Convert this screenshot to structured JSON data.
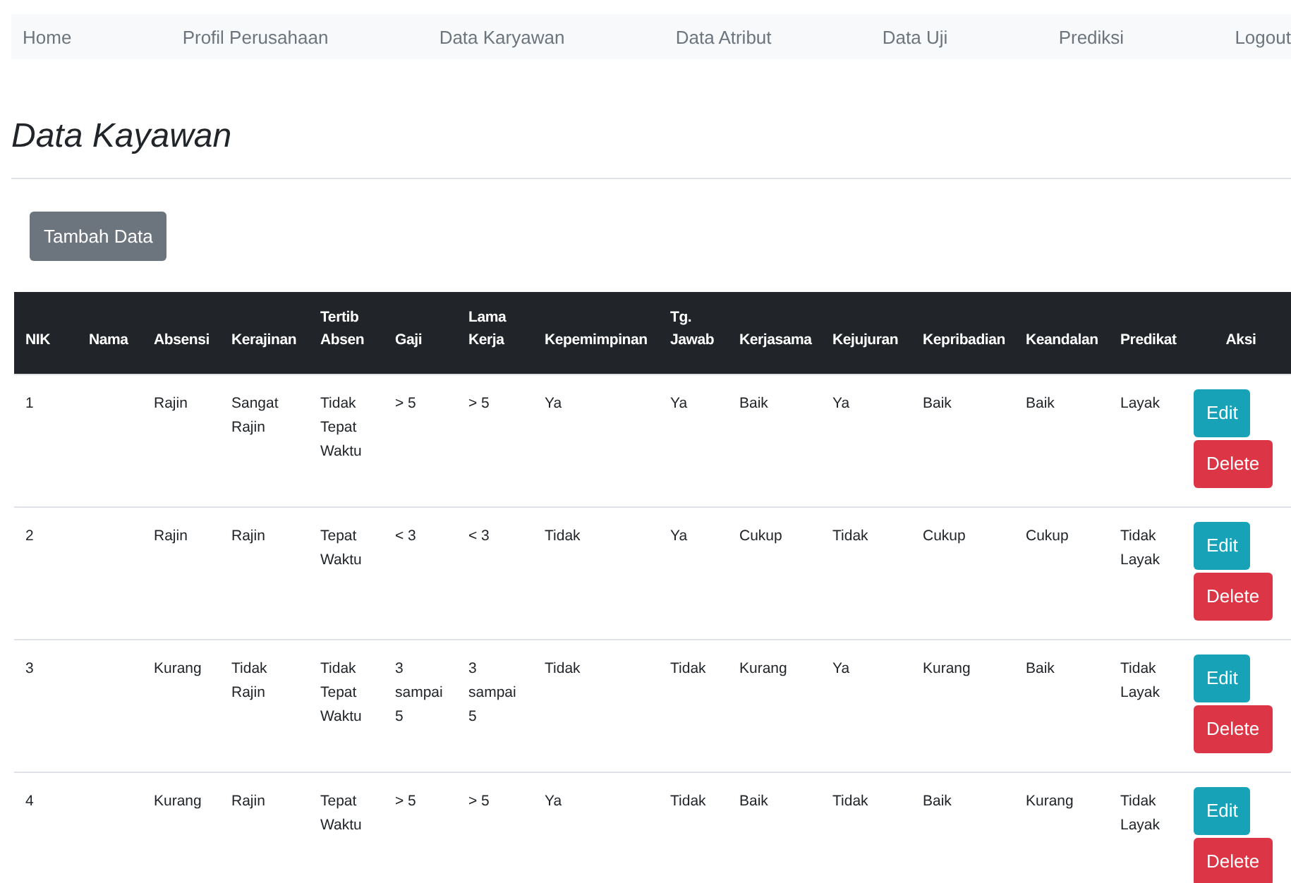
{
  "nav": [
    "Home",
    "Profil Perusahaan",
    "Data Karyawan",
    "Data Atribut",
    "Data Uji",
    "Prediksi",
    "Logout"
  ],
  "title": "Data Kayawan",
  "add_button": "Tambah Data",
  "table": {
    "columns": [
      "NIK",
      "Nama",
      "Absensi",
      "Kerajinan",
      "Tertib Absen",
      "Gaji",
      "Lama Kerja",
      "Kepemimpinan",
      "Tg. Jawab",
      "Kerjasama",
      "Kejujuran",
      "Kepribadian",
      "Keandalan",
      "Predikat",
      "Aksi"
    ],
    "rows": [
      {
        "cells": [
          "1",
          "",
          "Rajin",
          "Sangat Rajin",
          "Tidak Tepat Waktu",
          "> 5",
          "> 5",
          "Ya",
          "Ya",
          "Baik",
          "Ya",
          "Baik",
          "Baik",
          "Layak"
        ],
        "actions": [
          "Edit",
          "Delete"
        ]
      },
      {
        "cells": [
          "2",
          "",
          "Rajin",
          "Rajin",
          "Tepat Waktu",
          "< 3",
          "< 3",
          "Tidak",
          "Ya",
          "Cukup",
          "Tidak",
          "Cukup",
          "Cukup",
          "Tidak Layak"
        ],
        "actions": [
          "Edit",
          "Delete"
        ]
      },
      {
        "cells": [
          "3",
          "",
          "Kurang",
          "Tidak Rajin",
          "Tidak Tepat Waktu",
          "3 sampai 5",
          "3 sampai 5",
          "Tidak",
          "Tidak",
          "Kurang",
          "Ya",
          "Kurang",
          "Baik",
          "Tidak Layak"
        ],
        "actions": [
          "Edit",
          "Delete"
        ]
      },
      {
        "cells": [
          "4",
          "",
          "Kurang",
          "Rajin",
          "Tepat Waktu",
          "> 5",
          "> 5",
          "Ya",
          "Tidak",
          "Baik",
          "Tidak",
          "Baik",
          "Kurang",
          "Tidak Layak"
        ],
        "actions": [
          "Edit",
          "Delete"
        ]
      }
    ]
  }
}
